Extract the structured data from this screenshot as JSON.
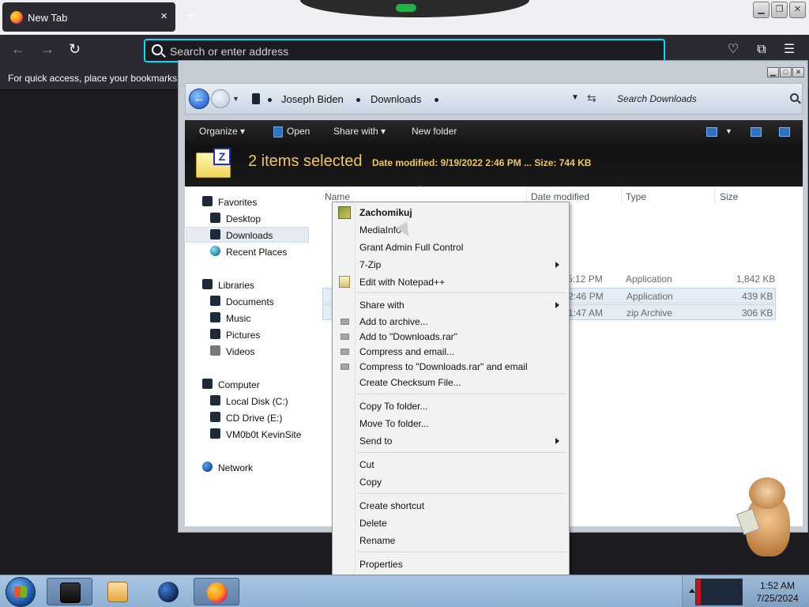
{
  "browser": {
    "tab_title": "New Tab",
    "tab_close": "×",
    "new_tab": "+",
    "url_placeholder": "Search or enter address",
    "bookmarks_hint": "For quick access, place your bookmarks h",
    "nav": {
      "back": "←",
      "forward": "→",
      "reload": "↻"
    },
    "right_icons": {
      "pocket": "pocket-icon",
      "extensions": "puzzle-icon",
      "menu": "☰"
    },
    "window_buttons": {
      "minimize": "▁",
      "restore": "❐",
      "close": "✕"
    },
    "colors": {
      "accent": "#00ddff",
      "toolbar": "#2b2a33",
      "page_bg": "#1c1b22"
    }
  },
  "explorer": {
    "breadcrumb": [
      "Joseph Biden",
      "Downloads"
    ],
    "search_placeholder": "Search Downloads",
    "window_buttons": {
      "minimize": "▁",
      "maximize": "□",
      "close": "✕"
    },
    "toolbar": {
      "organize": "Organize ▾",
      "open": "Open",
      "share_with": "Share with ▾",
      "new_folder": "New folder"
    },
    "details": {
      "selected_count": "2 items selected",
      "meta": "Date modified: 9/19/2022 2:46 PM ...  Size: 744 KB",
      "icon_letter": "Z"
    },
    "columns": {
      "name": "Name",
      "date_modified": "Date modified",
      "type": "Type",
      "size": "Size"
    },
    "files": [
      {
        "date": "5:12 PM",
        "type": "Application",
        "size": "1,842 KB",
        "selected": false
      },
      {
        "date": "2:46 PM",
        "type": "Application",
        "size": "439 KB",
        "selected": true
      },
      {
        "date": "1:47 AM",
        "type": "zip Archive",
        "size": "306 KB",
        "selected": true
      }
    ],
    "nav_pane": {
      "favorites": "Favorites",
      "desktop": "Desktop",
      "downloads": "Downloads",
      "recent_places": "Recent Places",
      "libraries": "Libraries",
      "documents": "Documents",
      "music": "Music",
      "pictures": "Pictures",
      "videos": "Videos",
      "computer": "Computer",
      "local_disk": "Local Disk (C:)",
      "cd_drive": "CD Drive (E:)",
      "vm_share": "VM0b0t KevinSite",
      "network": "Network"
    }
  },
  "context_menu": {
    "zachomikuj": "Zachomikuj",
    "mediainfo": "MediaInfo",
    "grant_admin": "Grant Admin Full Control",
    "seven_zip": "7-Zip",
    "edit_notepad": "Edit with Notepad++",
    "share_with": "Share with",
    "add_archive": "Add to archive...",
    "add_rar": "Add to \"Downloads.rar\"",
    "compress_email": "Compress and email...",
    "compress_rar_email": "Compress to \"Downloads.rar\" and email",
    "checksum": "Create Checksum File...",
    "copy_to": "Copy To folder...",
    "move_to": "Move To folder...",
    "send_to": "Send to",
    "cut": "Cut",
    "copy": "Copy",
    "create_shortcut": "Create shortcut",
    "delete": "Delete",
    "rename": "Rename",
    "properties": "Properties"
  },
  "taskbar": {
    "time": "1:52 AM",
    "date": "7/25/2024"
  }
}
